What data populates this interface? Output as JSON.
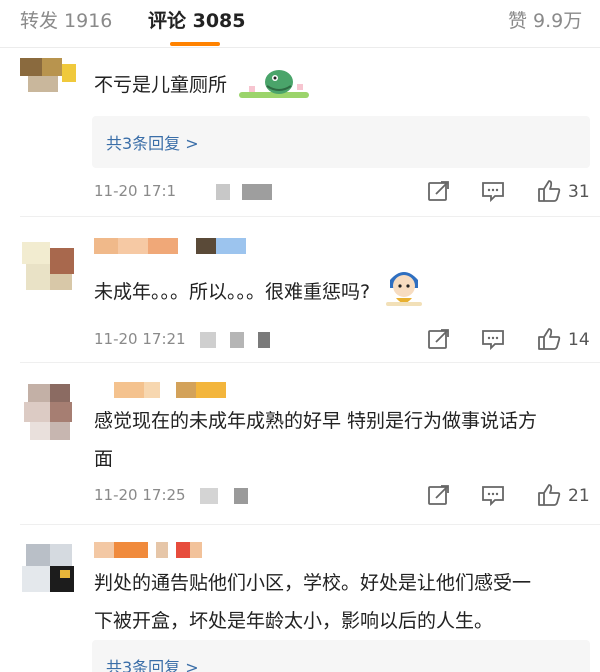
{
  "tabs": {
    "repost": "转发 1916",
    "comment": "评论 3085",
    "like": "赞 9.9万"
  },
  "comments": [
    {
      "text": "不亏是儿童厕所",
      "replies_label": "共3条回复 >",
      "time": "11-20 17:1",
      "likes": "31"
    },
    {
      "text": "未成年。。。所以。。。很难重惩吗?",
      "time": "11-20 17:21",
      "likes": "14"
    },
    {
      "text_line1": "感觉现在的未成年成熟的好早 特别是行为做事说话方",
      "text_line2": "面",
      "time": "11-20 17:25",
      "likes": "21"
    },
    {
      "text_line1": "判处的通告贴他们小区，学校。好处是让他们感受一",
      "text_line2": "下被开盒，坏处是年龄太小，影响以后的人生。",
      "replies_label": "共3条回复 >"
    }
  ],
  "icons": {
    "share": "share-icon",
    "reply": "comment-icon",
    "like": "thumbs-up-icon"
  },
  "colors": {
    "accent": "#ff8200",
    "link": "#3a6ea8",
    "muted": "#8a8a8a"
  }
}
